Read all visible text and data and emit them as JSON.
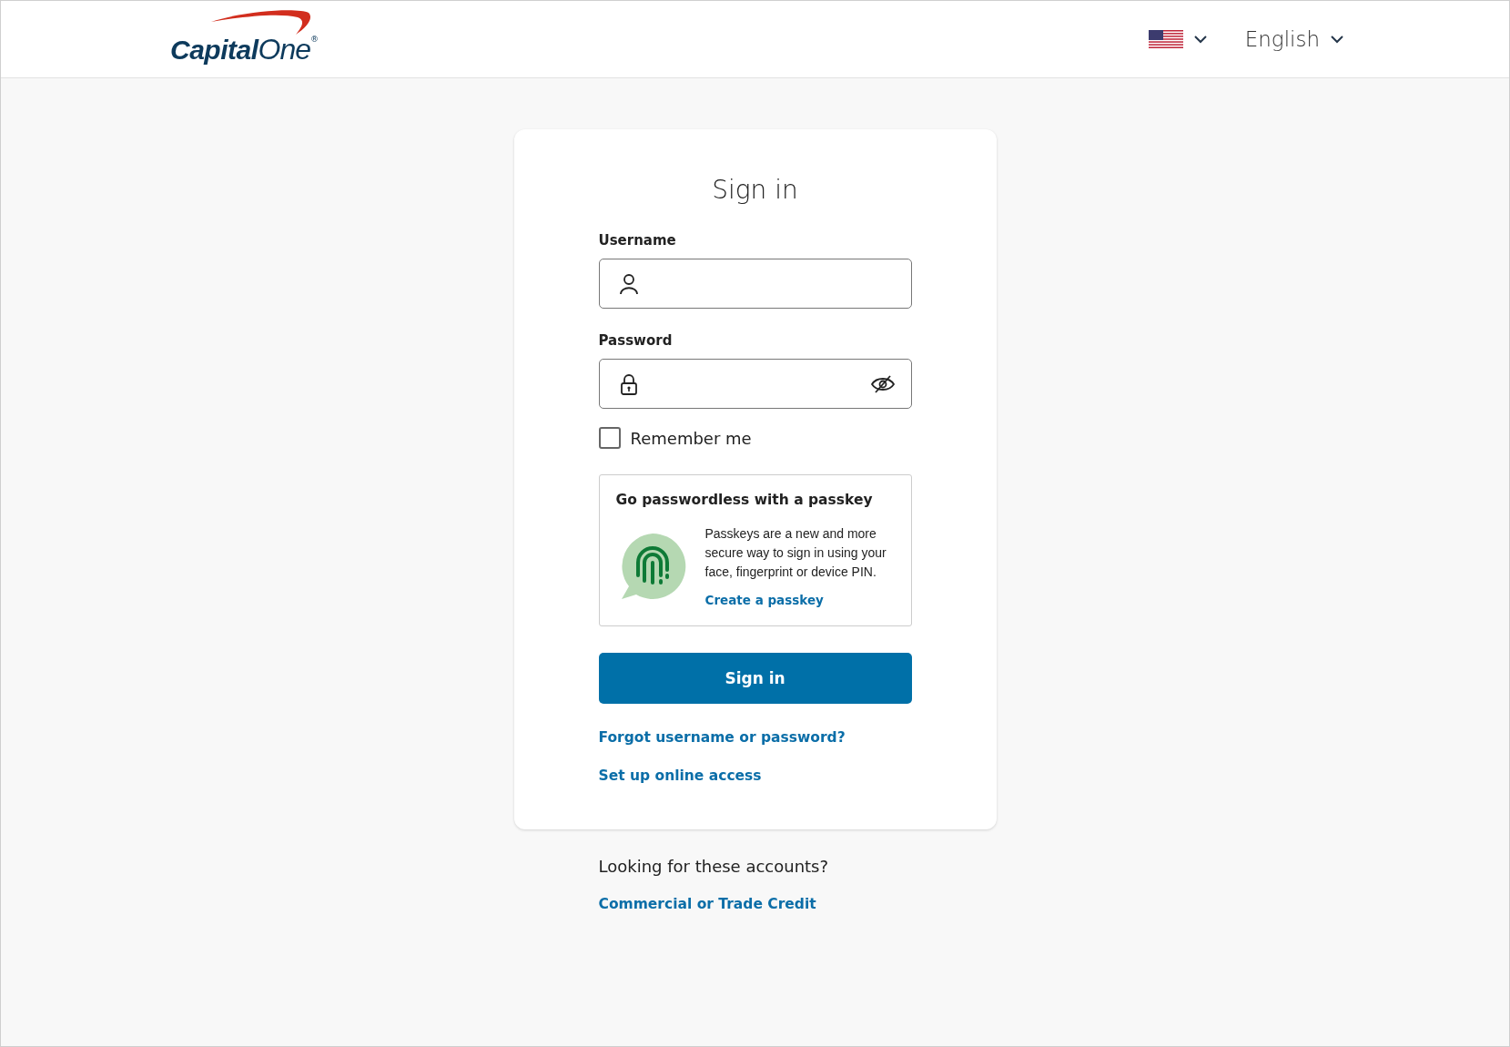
{
  "header": {
    "logo": {
      "word_1": "Capital",
      "word_2": "One",
      "mark": "®"
    },
    "region_select": {
      "expanded": false
    },
    "language_select": {
      "label": "English",
      "expanded": false
    }
  },
  "form": {
    "title": "Sign in",
    "fields": [
      {
        "kind": "username",
        "label": "Username"
      },
      {
        "kind": "password",
        "label": "Password",
        "show_password": false
      }
    ],
    "remember_me": {
      "label": "Remember me",
      "checked": false
    },
    "passkey": {
      "title": "Go passwordless with a passkey",
      "text": "Passkeys are a new and more secure way to sign in using your face, fingerprint or device PIN.",
      "link": "Create a passkey"
    },
    "submit": "Sign in",
    "links": [
      "Forgot username or password?",
      "Set up online access"
    ]
  },
  "footer": {
    "text": "Looking for these accounts?",
    "link": "Commercial or Trade Credit"
  }
}
